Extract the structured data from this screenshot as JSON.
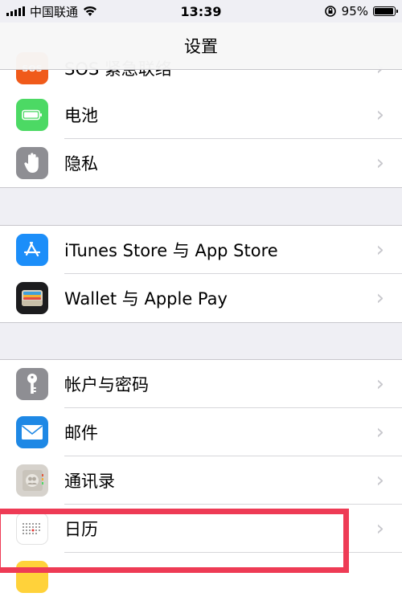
{
  "status_bar": {
    "carrier": "中国联通",
    "time": "13:39",
    "battery": "95%",
    "battery_level": 0.95
  },
  "nav": {
    "title": "设置"
  },
  "rows": {
    "sos": {
      "label": "SOS 紧急联络",
      "icon": "sos-icon",
      "color": "#f05a1a"
    },
    "battery": {
      "label": "电池",
      "icon": "battery-icon",
      "color": "#4cd964"
    },
    "privacy": {
      "label": "隐私",
      "icon": "hand-icon",
      "color": "#8e8e93"
    },
    "appstore": {
      "label": "iTunes Store 与 App Store",
      "icon": "app-store-icon",
      "color": "#1c8ef9"
    },
    "wallet": {
      "label": "Wallet 与 Apple Pay",
      "icon": "wallet-icon",
      "color": "#1c1c1e"
    },
    "accounts": {
      "label": "帐户与密码",
      "icon": "key-icon",
      "color": "#8e8e93"
    },
    "mail": {
      "label": "邮件",
      "icon": "mail-icon",
      "color": "#1e88e5"
    },
    "contacts": {
      "label": "通讯录",
      "icon": "contacts-icon",
      "color": "#d6d2cc"
    },
    "calendar": {
      "label": "日历",
      "icon": "calendar-icon",
      "color": "#ffffff"
    },
    "notes": {
      "label": "",
      "icon": "notes-icon",
      "color": "#ffd23a"
    }
  },
  "highlight_color": "#ee3b55"
}
